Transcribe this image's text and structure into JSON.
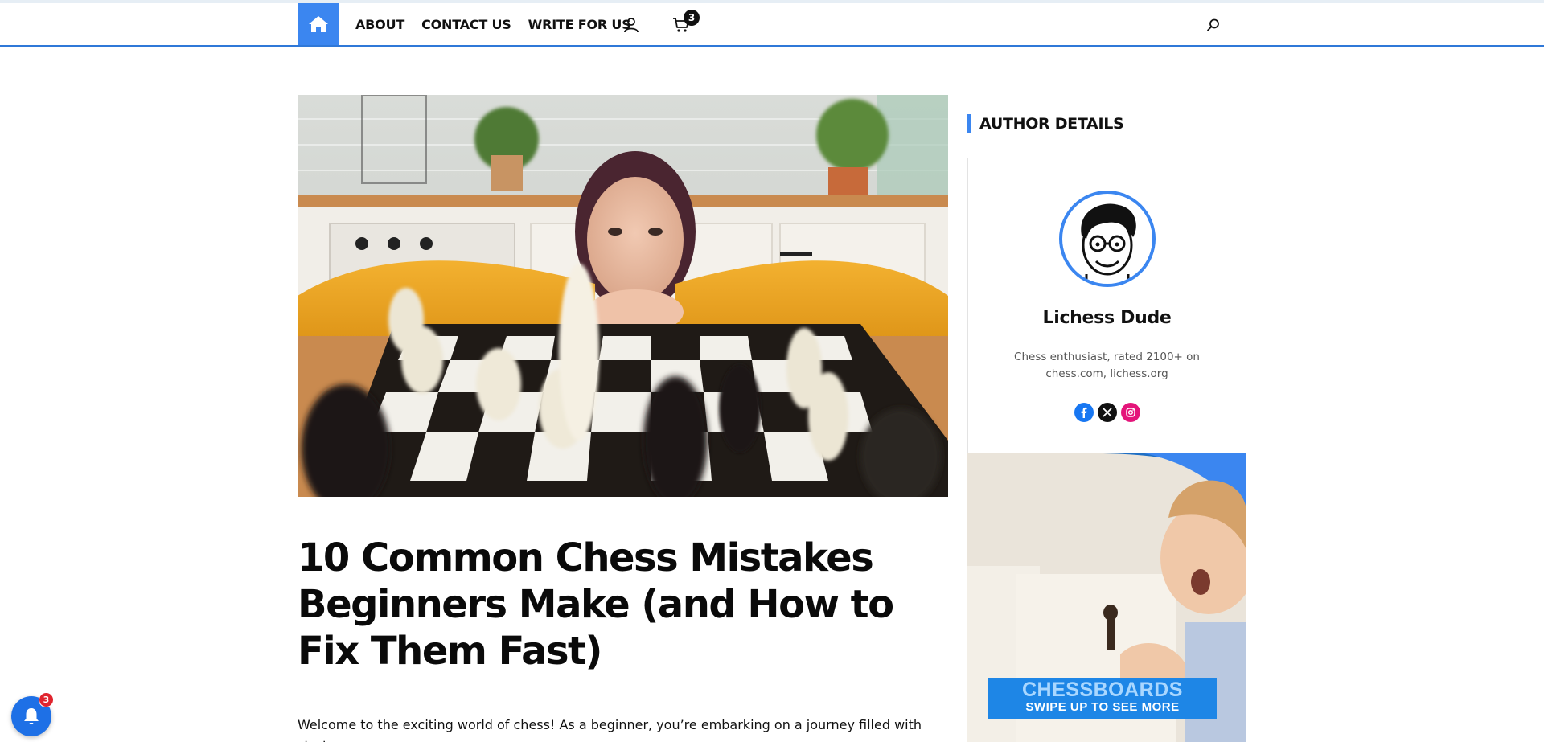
{
  "header": {
    "nav": [
      {
        "label": "ABOUT"
      },
      {
        "label": "CONTACT US"
      },
      {
        "label": "WRITE FOR US"
      }
    ],
    "cart_count": "3",
    "icons": [
      "home-icon",
      "user-icon",
      "cart-icon",
      "search-icon"
    ]
  },
  "article": {
    "title": "10 Common Chess Mistakes Beginners Make (and How to Fix Them Fast)",
    "intro": "Welcome to the exciting world of chess! As a beginner, you’re embarking on a journey filled with strategy,"
  },
  "sidebar": {
    "widget_title": "AUTHOR DETAILS",
    "author": {
      "name": "Lichess Dude",
      "bio": "Chess enthusiast, rated 2100+ on chess.com, lichess.org",
      "socials": [
        "facebook-icon",
        "x-icon",
        "instagram-icon"
      ]
    },
    "ad": {
      "headline": "CHESSBOARDS",
      "subline": "SWIPE UP TO SEE MORE"
    }
  },
  "notifications": {
    "count": "3"
  },
  "colors": {
    "accent": "#3b86f0",
    "facebook": "#1877f2",
    "x": "#111111",
    "instagram": "#e4157a"
  }
}
